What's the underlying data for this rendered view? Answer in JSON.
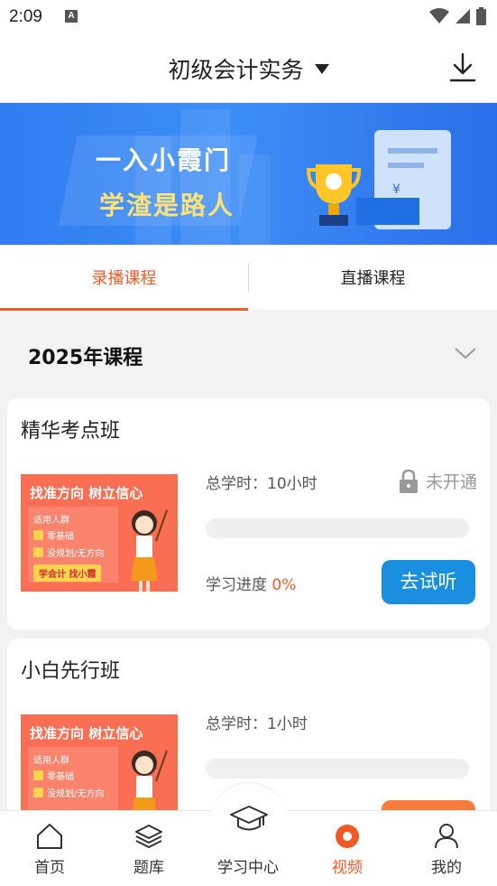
{
  "status_bar": {
    "time": "2:09",
    "app_icon_letter": "A"
  },
  "header": {
    "title": "初级会计实务",
    "dropdown_icon": "caret-down-icon",
    "download_icon": "download-icon"
  },
  "banner": {
    "line1": "一入小霞门",
    "line2": "学渣是路人"
  },
  "tabs": [
    {
      "label": "录播课程",
      "active": true
    },
    {
      "label": "直播课程",
      "active": false
    }
  ],
  "section": {
    "title": "2025年课程"
  },
  "thumbnail": {
    "headline": "找准方向 树立信心",
    "audience": "适用人群",
    "bullets": [
      "零基础",
      "没规划/无方向"
    ],
    "slogan": "学会计 找小霞"
  },
  "courses": [
    {
      "name": "精华考点班",
      "hours_label": "总学时：",
      "hours": "10小时",
      "lock_text": "未开通",
      "progress_label": "学习进度",
      "progress_value": "0%",
      "progress": 0,
      "button": "去试听"
    },
    {
      "name": "小白先行班",
      "hours_label": "总学时：",
      "hours": "1小时",
      "progress": 0
    }
  ],
  "bottom_nav": [
    {
      "label": "首页",
      "icon": "home-icon"
    },
    {
      "label": "题库",
      "icon": "layers-icon"
    },
    {
      "label": "学习中心",
      "icon": "graduation-cap-icon"
    },
    {
      "label": "视频",
      "icon": "video-icon",
      "active": true
    },
    {
      "label": "我的",
      "icon": "user-icon"
    }
  ],
  "colors": {
    "accent": "#f05a28",
    "primary_button": "#1a8fe0",
    "banner": "#3d8ef7"
  }
}
